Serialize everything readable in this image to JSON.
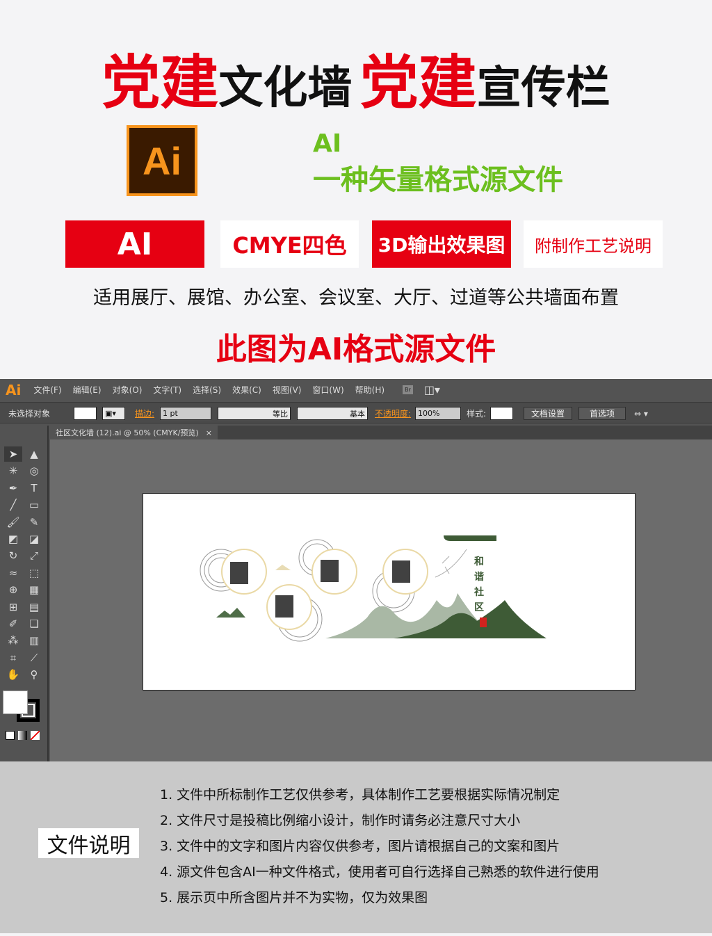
{
  "header": {
    "title_part1": "党建",
    "title_part2": "文化墙",
    "title_part3": "党建",
    "title_part4": "宣传栏"
  },
  "logo": {
    "text": "Ai"
  },
  "format": {
    "line1": "AI",
    "line2": "一种矢量格式源文件"
  },
  "badges": [
    "AI",
    "CMYE四色",
    "3D输出效果图",
    "附制作工艺说明"
  ],
  "usage": "适用展厅、展馆、办公室、会议室、大厅、过道等公共墙面布置",
  "notice": "此图为AI格式源文件",
  "colors": {
    "red": "#e60012",
    "green": "#6cbf1f",
    "orange": "#f7941d",
    "dark_green": "#3e5b36"
  },
  "illustrator": {
    "app_logo": "Ai",
    "menu": [
      "文件(F)",
      "编辑(E)",
      "对象(O)",
      "文字(T)",
      "选择(S)",
      "效果(C)",
      "视图(V)",
      "窗口(W)",
      "帮助(H)"
    ],
    "bridge_label": "Br",
    "control": {
      "selection": "未选择对象",
      "stroke_label": "描边:",
      "stroke_value": "1 pt",
      "profile": "等比",
      "brush": "基本",
      "opacity_label": "不透明度:",
      "opacity_value": "100%",
      "style_label": "样式:",
      "doc_setup": "文档设置",
      "preferences": "首选项"
    },
    "doc_tab": {
      "title": "社区文化墙 (12).ai @ 50% (CMYK/预览)",
      "close": "×"
    },
    "tools": [
      [
        "selection-tool",
        "➤"
      ],
      [
        "direct-selection-tool",
        "▲"
      ],
      [
        "magic-wand-tool",
        "✳"
      ],
      [
        "lasso-tool",
        "◎"
      ],
      [
        "pen-tool",
        "✒"
      ],
      [
        "type-tool",
        "T"
      ],
      [
        "line-tool",
        "╱"
      ],
      [
        "rectangle-tool",
        "▭"
      ],
      [
        "paintbrush-tool",
        "🖌"
      ],
      [
        "pencil-tool",
        "✎"
      ],
      [
        "blob-brush-tool",
        "◩"
      ],
      [
        "eraser-tool",
        "◪"
      ],
      [
        "rotate-tool",
        "↻"
      ],
      [
        "scale-tool",
        "⤢"
      ],
      [
        "warp-tool",
        "≈"
      ],
      [
        "free-transform-tool",
        "⬚"
      ],
      [
        "shape-builder-tool",
        "⊕"
      ],
      [
        "perspective-grid-tool",
        "▦"
      ],
      [
        "mesh-tool",
        "⊞"
      ],
      [
        "gradient-tool",
        "▤"
      ],
      [
        "eyedropper-tool",
        "✐"
      ],
      [
        "blend-tool",
        "❏"
      ],
      [
        "symbol-sprayer-tool",
        "⁂"
      ],
      [
        "column-graph-tool",
        "▥"
      ],
      [
        "artboard-tool",
        "⌗"
      ],
      [
        "slice-tool",
        "⟋"
      ],
      [
        "hand-tool",
        "✋"
      ],
      [
        "zoom-tool",
        "⚲"
      ]
    ],
    "artwork": {
      "title_chars": [
        "和",
        "谐",
        "社",
        "区"
      ]
    }
  },
  "file_notes": {
    "label": "文件说明",
    "items": [
      "1. 文件中所标制作工艺仅供参考，具体制作工艺要根据实际情况制定",
      "2. 文件尺寸是投稿比例缩小设计，制作时请务必注意尺寸大小",
      "3. 文件中的文字和图片内容仅供参考，图片请根据自己的文案和图片",
      "4. 源文件包含AI一种文件格式，使用者可自行选择自己熟悉的软件进行使用",
      "5. 展示页中所含图片并不为实物，仅为效果图"
    ]
  }
}
